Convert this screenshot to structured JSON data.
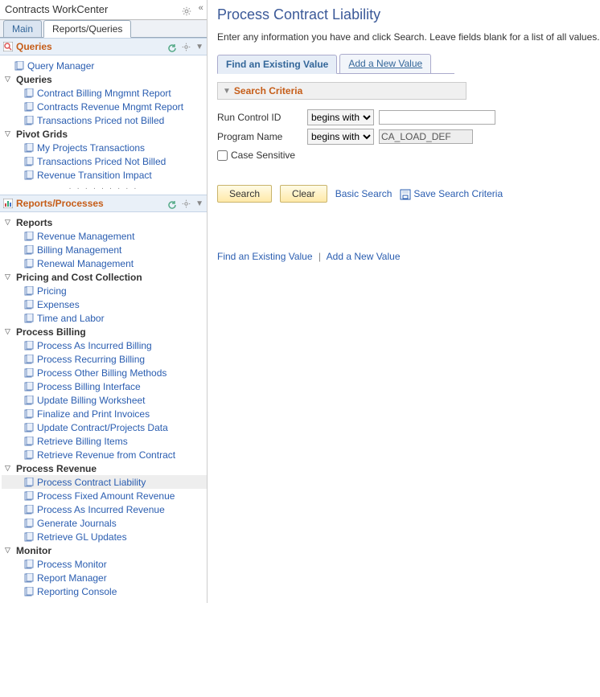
{
  "workcenter": {
    "title": "Contracts WorkCenter",
    "tabs": {
      "main": "Main",
      "reports": "Reports/Queries"
    }
  },
  "queries_section": {
    "title": "Queries",
    "query_manager": "Query Manager",
    "groups": [
      {
        "label": "Queries",
        "items": [
          "Contract Billing Mngmnt Report",
          "Contracts Revenue Mngmt Report",
          "Transactions Priced not Billed"
        ]
      },
      {
        "label": "Pivot Grids",
        "items": [
          "My Projects Transactions",
          "Transactions Priced Not Billed",
          "Revenue Transition Impact"
        ]
      }
    ]
  },
  "reports_section": {
    "title": "Reports/Processes",
    "groups": [
      {
        "label": "Reports",
        "items": [
          "Revenue Management",
          "Billing Management",
          "Renewal Management"
        ]
      },
      {
        "label": "Pricing and Cost Collection",
        "items": [
          "Pricing",
          "Expenses",
          "Time and Labor"
        ]
      },
      {
        "label": "Process Billing",
        "items": [
          "Process As Incurred Billing",
          "Process Recurring Billing",
          "Process Other Billing Methods",
          "Process Billing Interface",
          "Update Billing Worksheet",
          "Finalize and Print Invoices",
          "Update Contract/Projects Data",
          "Retrieve Billing Items",
          "Retrieve Revenue from Contract"
        ]
      },
      {
        "label": "Process Revenue",
        "selected_index": 0,
        "items": [
          "Process Contract Liability",
          "Process Fixed Amount Revenue",
          "Process As Incurred Revenue",
          "Generate Journals",
          "Retrieve GL Updates"
        ]
      },
      {
        "label": "Monitor",
        "items": [
          "Process Monitor",
          "Report Manager",
          "Reporting Console"
        ]
      }
    ]
  },
  "main_page": {
    "title": "Process Contract Liability",
    "instruction": "Enter any information you have and click Search. Leave fields blank for a list of all values.",
    "tabs": {
      "find": "Find an Existing Value",
      "add": "Add a New Value"
    },
    "criteria_title": "Search Criteria",
    "fields": {
      "run_control": {
        "label": "Run Control ID",
        "op": "begins with",
        "value": ""
      },
      "program": {
        "label": "Program Name",
        "op": "begins with",
        "value": "CA_LOAD_DEF"
      }
    },
    "case_sensitive": "Case Sensitive",
    "buttons": {
      "search": "Search",
      "clear": "Clear",
      "basic": "Basic Search",
      "save": "Save Search Criteria"
    },
    "bottom": {
      "find": "Find an Existing Value",
      "add": "Add a New Value"
    }
  }
}
